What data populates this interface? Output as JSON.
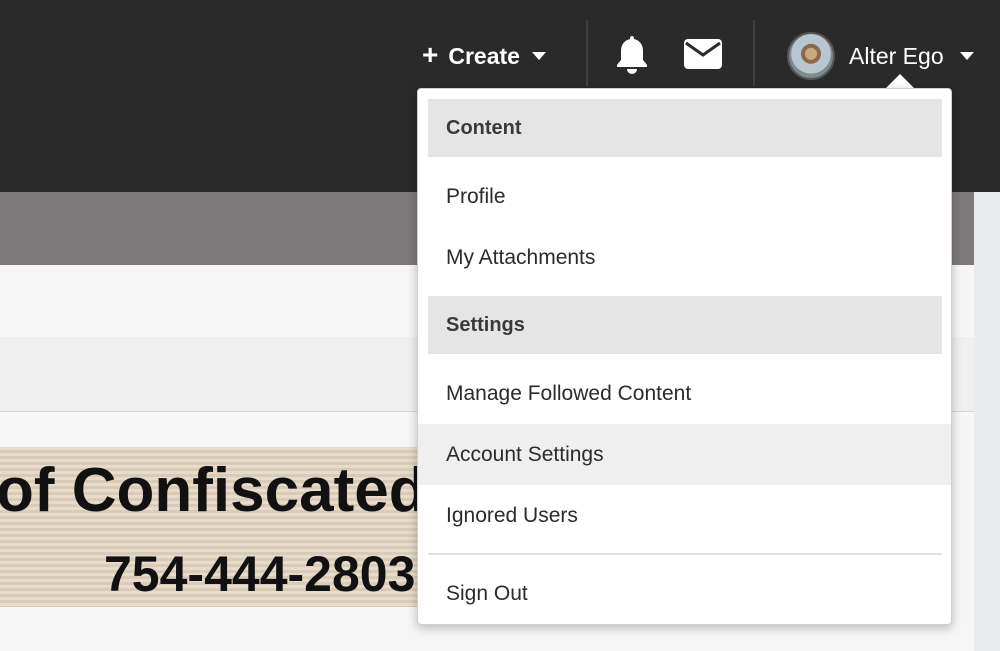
{
  "header": {
    "create_label": "Create",
    "user_name": "Alter Ego"
  },
  "icons": {
    "plus": "plus-icon",
    "caret": "chevron-down-icon",
    "notifications": "bell-icon",
    "messages": "envelope-icon"
  },
  "background": {
    "banner_line1": "of Confiscated",
    "banner_line2": "754-444-2803"
  },
  "menu": {
    "content_header": "Content",
    "profile": "Profile",
    "attachments": "My Attachments",
    "settings_header": "Settings",
    "followed": "Manage Followed Content",
    "account_settings": "Account Settings",
    "ignored": "Ignored Users",
    "sign_out": "Sign Out"
  },
  "colors": {
    "topbar": "#2a2a2a",
    "accent_gray": "#7d797a",
    "header_bg": "#e5e5e5",
    "hover_bg": "#efefef"
  }
}
